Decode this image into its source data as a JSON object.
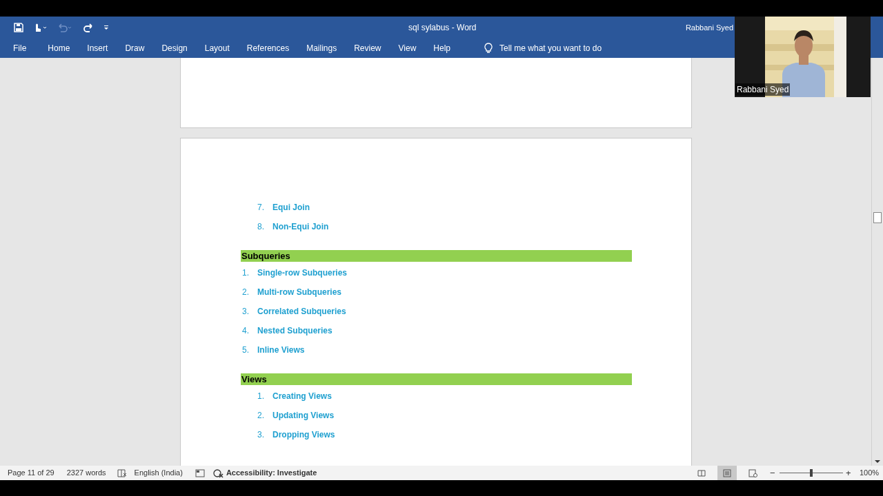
{
  "window": {
    "title": "sql sylabus  -  Word",
    "user": "Rabbani Syed"
  },
  "ribbon_tabs": [
    "File",
    "Home",
    "Insert",
    "Draw",
    "Design",
    "Layout",
    "References",
    "Mailings",
    "Review",
    "View",
    "Help"
  ],
  "tell_me": {
    "placeholder": "Tell me what you want to do"
  },
  "document": {
    "blocks": [
      {
        "kind": "list",
        "nested": true,
        "items": [
          {
            "number": "7.",
            "text": "Equi Join"
          },
          {
            "number": "8.",
            "text": "Non-Equi Join"
          }
        ]
      },
      {
        "kind": "heading",
        "text": "Subqueries"
      },
      {
        "kind": "list",
        "nested": false,
        "items": [
          {
            "number": "1.",
            "text": "Single-row Subqueries"
          },
          {
            "number": "2.",
            "text": "Multi-row Subqueries"
          },
          {
            "number": "3.",
            "text": "Correlated Subqueries"
          },
          {
            "number": "4.",
            "text": "Nested Subqueries"
          },
          {
            "number": "5.",
            "text": "Inline Views"
          }
        ]
      },
      {
        "kind": "heading",
        "text": "Views"
      },
      {
        "kind": "list",
        "nested": true,
        "items": [
          {
            "number": "1.",
            "text": "Creating Views"
          },
          {
            "number": "2.",
            "text": "Updating Views"
          },
          {
            "number": "3.",
            "text": "Dropping Views"
          }
        ]
      }
    ]
  },
  "status_bar": {
    "page": "Page 11 of 29",
    "words": "2327 words",
    "language": "English (India)",
    "accessibility": "Accessibility: Investigate",
    "views": [
      {
        "kind": "read",
        "selected": false
      },
      {
        "kind": "print",
        "selected": true
      },
      {
        "kind": "web",
        "selected": false
      }
    ],
    "zoom": {
      "out": "−",
      "in": "+",
      "level": 0.5,
      "reading": "100%"
    }
  },
  "video": {
    "name": "Rabbani Syed"
  }
}
